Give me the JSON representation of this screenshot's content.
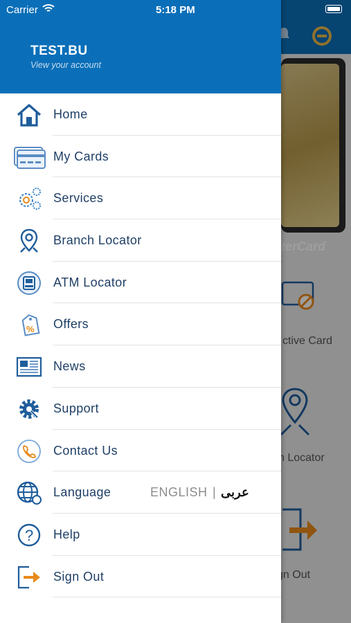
{
  "status_bar": {
    "carrier": "Carrier",
    "time": "5:18 PM"
  },
  "account": {
    "name": "TEST.BU",
    "subtitle": "View your account"
  },
  "menu": {
    "items": [
      {
        "label": "Home",
        "icon": "home-icon"
      },
      {
        "label": "My Cards",
        "icon": "cards-icon"
      },
      {
        "label": "Services",
        "icon": "gears-icon"
      },
      {
        "label": "Branch Locator",
        "icon": "location-pin-icon"
      },
      {
        "label": "ATM Locator",
        "icon": "atm-icon"
      },
      {
        "label": "Offers",
        "icon": "offer-tag-icon"
      },
      {
        "label": "News",
        "icon": "newspaper-icon"
      },
      {
        "label": "Support",
        "icon": "support-gear-icon"
      },
      {
        "label": "Contact Us",
        "icon": "phone-icon"
      },
      {
        "label": "Language",
        "icon": "globe-icon"
      },
      {
        "label": "Help",
        "icon": "help-icon"
      },
      {
        "label": "Sign Out",
        "icon": "sign-out-icon"
      }
    ]
  },
  "language": {
    "english": "ENGLISH",
    "separator": "|",
    "arabic": "عربى"
  },
  "background": {
    "card_brand": "terCard",
    "labels": [
      "ctive Card",
      "h Locator",
      "gn Out"
    ]
  },
  "colors": {
    "brand_blue": "#0a6fb8",
    "menu_text": "#1f3f66",
    "accent_orange": "#e88a1a"
  }
}
